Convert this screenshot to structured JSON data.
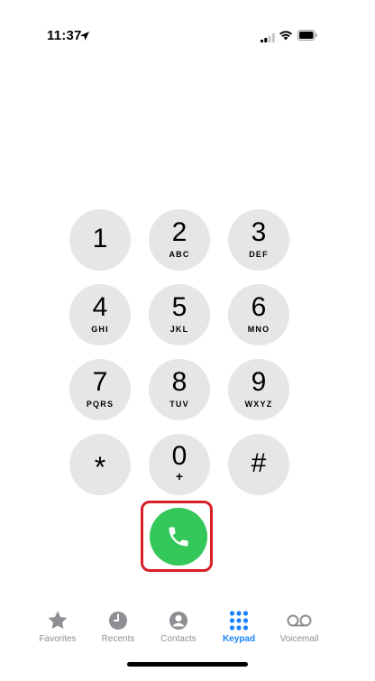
{
  "status_bar": {
    "time": "11:37",
    "location_icon": "location-arrow-icon",
    "signal_icon": "cellular-signal-icon",
    "wifi_icon": "wifi-icon",
    "battery_icon": "battery-icon"
  },
  "keypad": {
    "keys": [
      {
        "digit": "1",
        "letters": ""
      },
      {
        "digit": "2",
        "letters": "ABC"
      },
      {
        "digit": "3",
        "letters": "DEF"
      },
      {
        "digit": "4",
        "letters": "GHI"
      },
      {
        "digit": "5",
        "letters": "JKL"
      },
      {
        "digit": "6",
        "letters": "MNO"
      },
      {
        "digit": "7",
        "letters": "PQRS"
      },
      {
        "digit": "8",
        "letters": "TUV"
      },
      {
        "digit": "9",
        "letters": "WXYZ"
      },
      {
        "digit": "*",
        "letters": ""
      },
      {
        "digit": "0",
        "letters": "+"
      },
      {
        "digit": "#",
        "letters": ""
      }
    ],
    "call_icon": "phone-icon",
    "call_color": "#34c759",
    "highlight_color": "#d61f26"
  },
  "tab_bar": {
    "active_color": "#1a84ff",
    "inactive_color": "#8e8e93",
    "tabs": [
      {
        "label": "Favorites",
        "icon": "star-icon"
      },
      {
        "label": "Recents",
        "icon": "clock-icon"
      },
      {
        "label": "Contacts",
        "icon": "person-circle-icon"
      },
      {
        "label": "Keypad",
        "icon": "keypad-grid-icon"
      },
      {
        "label": "Voicemail",
        "icon": "voicemail-icon"
      }
    ]
  }
}
